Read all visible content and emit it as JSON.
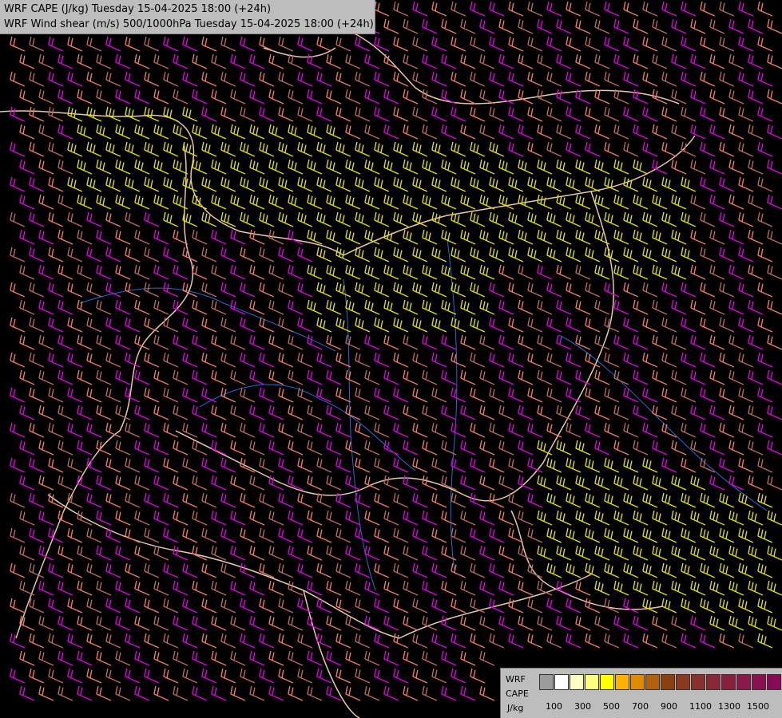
{
  "title": {
    "line1": "WRF CAPE (J/kg) Tuesday 15-04-2025 18:00 (+24h)",
    "line2": "WRF Wind shear (m/s) 500/1000hPa Tuesday 15-04-2025 18:00 (+24h)"
  },
  "legend": {
    "model": "WRF",
    "variable": "CAPE",
    "unit": "J/kg",
    "colors": [
      "#9b9b9b",
      "#ffffff",
      "#fffcc0",
      "#ffff80",
      "#ffff00",
      "#ffb000",
      "#e08a00",
      "#b06010",
      "#8a4010",
      "#8a3a20",
      "#8a3030",
      "#8a2838",
      "#8a2040",
      "#8a1848",
      "#8a1050",
      "#8a0858",
      "#7a0060",
      "#8a006a"
    ],
    "tick_labels": [
      "100",
      "300",
      "500",
      "700",
      "900",
      "1100",
      "1300",
      "1500"
    ]
  },
  "barb_colors": {
    "low": "#e0e000",
    "mid": "#f07a6a",
    "mid2": "#b86a60",
    "high": "#e000e0"
  },
  "map": {
    "background": "#000000",
    "border_color": "#e8c8a8",
    "river_color": "#2a6ad0"
  }
}
